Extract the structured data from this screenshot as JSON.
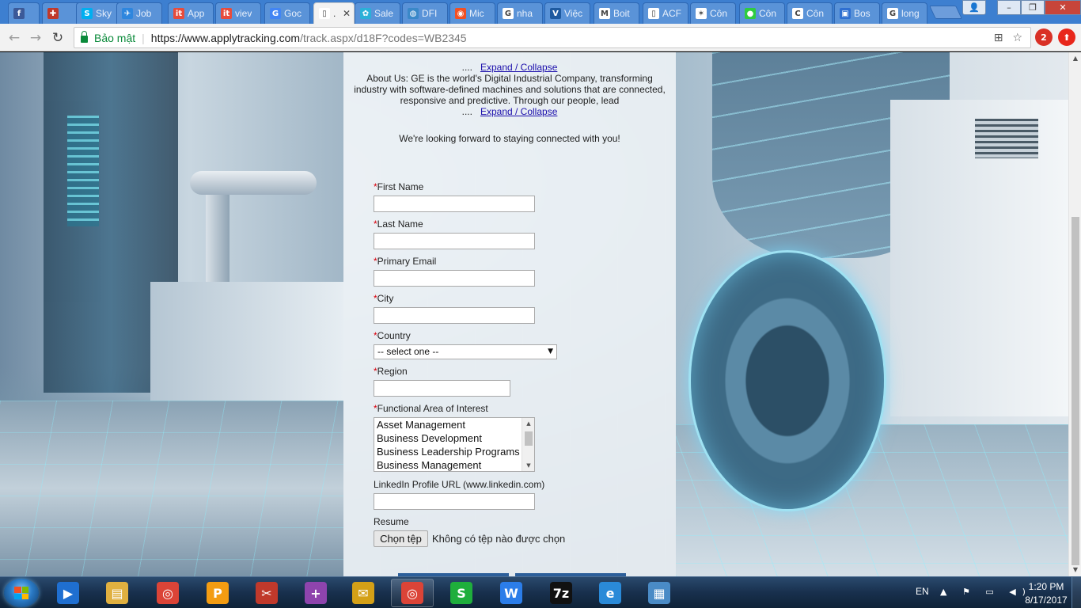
{
  "browser": {
    "tabs": [
      {
        "label": "",
        "icon": "facebook-icon",
        "color": "#3b5998",
        "glyph": "f"
      },
      {
        "label": "",
        "icon": "puzzle-icon",
        "color": "#c0392b",
        "glyph": "✚"
      },
      {
        "label": "Sky",
        "icon": "skype-icon",
        "color": "#00aff0",
        "glyph": "S"
      },
      {
        "label": "Job",
        "icon": "plane-icon",
        "color": "#2e86de",
        "glyph": "✈"
      },
      {
        "label": "App",
        "icon": "it-icon",
        "color": "#e74c3c",
        "glyph": "it"
      },
      {
        "label": "viev",
        "icon": "it-icon",
        "color": "#e74c3c",
        "glyph": "it"
      },
      {
        "label": "Goc",
        "icon": "translate-icon",
        "color": "#4285f4",
        "glyph": "G"
      },
      {
        "label": ".",
        "icon": "document-icon",
        "color": "#ffffff",
        "glyph": "▯",
        "active": true
      },
      {
        "label": "Sale",
        "icon": "gear-icon",
        "color": "#2bb0d8",
        "glyph": "✿"
      },
      {
        "label": "DFI",
        "icon": "globe-icon",
        "color": "#3a88c8",
        "glyph": "◍"
      },
      {
        "label": "Mic",
        "icon": "microsoft-icon",
        "color": "#f25022",
        "glyph": "◉"
      },
      {
        "label": "nha",
        "icon": "google-icon",
        "color": "#ffffff",
        "glyph": "G"
      },
      {
        "label": "Việc",
        "icon": "viec-icon",
        "color": "#1e5aa0",
        "glyph": "V"
      },
      {
        "label": "Boit",
        "icon": "gmail-icon",
        "color": "#ffffff",
        "glyph": "M"
      },
      {
        "label": "ACF",
        "icon": "document-icon",
        "color": "#ffffff",
        "glyph": "▯"
      },
      {
        "label": "Côn",
        "icon": "star-icon",
        "color": "#ffffff",
        "glyph": "✶"
      },
      {
        "label": "Côn",
        "icon": "green-circle-icon",
        "color": "#2ecc40",
        "glyph": "●"
      },
      {
        "label": "Côn",
        "icon": "c-icon",
        "color": "#ffffff",
        "glyph": "C"
      },
      {
        "label": "Bos",
        "icon": "briefcase-icon",
        "color": "#2e6fd1",
        "glyph": "▣"
      },
      {
        "label": "long",
        "icon": "google-icon",
        "color": "#ffffff",
        "glyph": "G"
      }
    ],
    "window_buttons": {
      "user": "👤",
      "minimize": "–",
      "maximize": "❐",
      "close": "✕"
    },
    "secure_label": "Bảo mật",
    "url_host": "https://www.applytracking.com",
    "url_path": "/track.aspx/d18F?codes=WB2345",
    "ext_badge": "2"
  },
  "page": {
    "expand_top": "Expand / Collapse",
    "ellipsis": "....",
    "about_text": "About Us: GE is the world's Digital Industrial Company, transforming industry with software-defined machines and solutions that are connected, responsive and predictive. Through our people, lead",
    "expand_bottom": "Expand / Collapse",
    "looking_forward": "We're looking forward to staying connected with you!",
    "required_mark": "*",
    "fields": {
      "first_name": "First Name",
      "last_name": "Last Name",
      "primary_email": "Primary Email",
      "city": "City",
      "country": "Country",
      "region": "Region",
      "functional_area": "Functional Area of Interest",
      "linkedin": "LinkedIn Profile URL (www.linkedin.com)",
      "resume": "Resume"
    },
    "country_selected": "-- select one --",
    "functional_options": [
      "Asset Management",
      "Business Development",
      "Business Leadership Programs",
      "Business Management"
    ],
    "file_button": "Chọn tệp",
    "file_status": "Không có tệp nào được chọn"
  },
  "taskbar": {
    "items": [
      {
        "name": "media-player-icon",
        "color": "#1f6fd1",
        "glyph": "▶"
      },
      {
        "name": "file-explorer-icon",
        "color": "#e0b040",
        "glyph": "▤"
      },
      {
        "name": "chrome-icon",
        "color": "#db4437",
        "glyph": "◎"
      },
      {
        "name": "foxit-pdf-icon",
        "color": "#f39c12",
        "glyph": "P"
      },
      {
        "name": "snipping-tool-icon",
        "color": "#c0392b",
        "glyph": "✂"
      },
      {
        "name": "unikey-plus-icon",
        "color": "#8e44ad",
        "glyph": "+"
      },
      {
        "name": "mail-icon",
        "color": "#d4a017",
        "glyph": "✉"
      },
      {
        "name": "chrome-icon",
        "color": "#db4437",
        "glyph": "◎"
      },
      {
        "name": "sheets-icon",
        "color": "#1fae3c",
        "glyph": "S"
      },
      {
        "name": "writer-icon",
        "color": "#2b7de9",
        "glyph": "W"
      },
      {
        "name": "7zip-icon",
        "color": "#111111",
        "glyph": "7z"
      },
      {
        "name": "internet-explorer-icon",
        "color": "#2a8ad8",
        "glyph": "e"
      },
      {
        "name": "photo-viewer-icon",
        "color": "#4a8bc6",
        "glyph": "▦"
      }
    ],
    "language": "EN",
    "tray_icons": "▲ ⚑ ▭ ◀)",
    "time": "1:20 PM",
    "date": "8/17/2017"
  }
}
